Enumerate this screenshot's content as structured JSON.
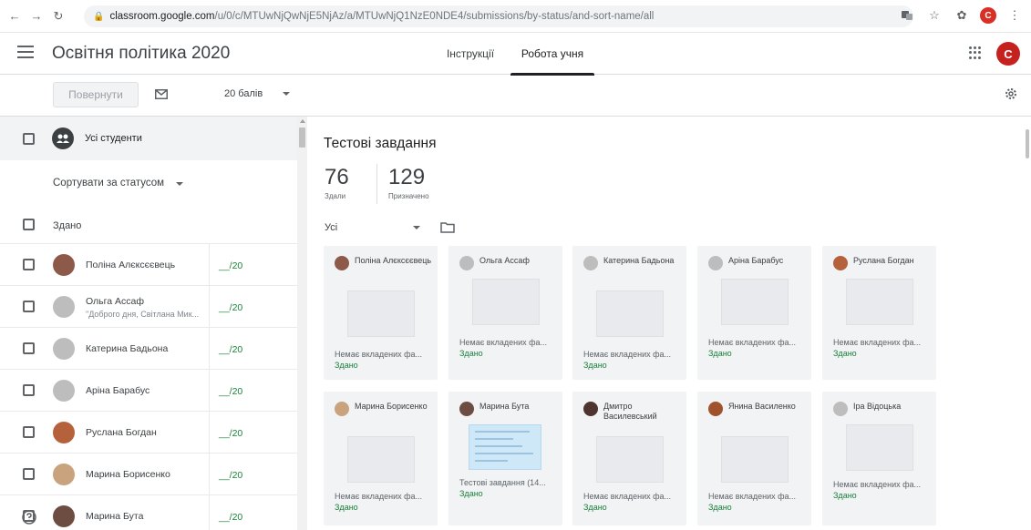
{
  "browser": {
    "url_host": "classroom.google.com",
    "url_path": "/u/0/c/MTUwNjQwNjE5NjAz/a/MTUwNjQ1NzE0NDE4/submissions/by-status/and-sort-name/all",
    "profile_initial": "C"
  },
  "header": {
    "class_title": "Освітня політика 2020",
    "tabs": [
      {
        "label": "Інструкції"
      },
      {
        "label": "Робота учня"
      }
    ],
    "avatar_initial": "C"
  },
  "toolbar": {
    "return_label": "Повернути",
    "points": "20 балів"
  },
  "left": {
    "all_students_label": "Усі студенти",
    "sort_label": "Сортувати за статусом",
    "group_label": "Здано",
    "students": [
      {
        "name": "Поліна Алєксєєвець",
        "comment": "",
        "grade": "__/20",
        "avatar_color": "#8d5a4a"
      },
      {
        "name": "Ольга Ассаф",
        "comment": "\"Доброго дня, Світлана Мик...",
        "grade": "__/20",
        "avatar_color": "#bdbdbd"
      },
      {
        "name": "Катерина Бадьона",
        "comment": "",
        "grade": "__/20",
        "avatar_color": "#bdbdbd"
      },
      {
        "name": "Аріна Барабус",
        "comment": "",
        "grade": "__/20",
        "avatar_color": "#bdbdbd"
      },
      {
        "name": "Руслана Богдан",
        "comment": "",
        "grade": "__/20",
        "avatar_color": "#b5623c"
      },
      {
        "name": "Марина Борисенко",
        "comment": "",
        "grade": "__/20",
        "avatar_color": "#c9a27e"
      },
      {
        "name": "Марина Бута",
        "comment": "",
        "grade": "__/20",
        "avatar_color": "#6d4c41"
      }
    ]
  },
  "right": {
    "assignment_title": "Тестові завдання",
    "turned_in_count": "76",
    "turned_in_label": "Здали",
    "assigned_count": "129",
    "assigned_label": "Призначено",
    "filter_label": "Усі",
    "cards": [
      {
        "name": "Поліна Алєксєєвець",
        "attachment": "Немає вкладених фа...",
        "status": "Здано",
        "avatar_color": "#8d5a4a",
        "has_doc": false
      },
      {
        "name": "Ольга Ассаф",
        "attachment": "Немає вкладених фа...",
        "status": "Здано",
        "avatar_color": "#bdbdbd",
        "has_doc": false
      },
      {
        "name": "Катерина Бадьона",
        "attachment": "Немає вкладених фа...",
        "status": "Здано",
        "avatar_color": "#bdbdbd",
        "has_doc": false
      },
      {
        "name": "Аріна Барабус",
        "attachment": "Немає вкладених фа...",
        "status": "Здано",
        "avatar_color": "#bdbdbd",
        "has_doc": false
      },
      {
        "name": "Руслана Богдан",
        "attachment": "Немає вкладених фа...",
        "status": "Здано",
        "avatar_color": "#b5623c",
        "has_doc": false
      },
      {
        "name": "Марина Борисенко",
        "attachment": "Немає вкладених фа...",
        "status": "Здано",
        "avatar_color": "#c9a27e",
        "has_doc": false
      },
      {
        "name": "Марина Бута",
        "attachment": "Тестові завдання (14...",
        "status": "Здано",
        "avatar_color": "#6d4c41",
        "has_doc": true
      },
      {
        "name": "Дмитро Василевський",
        "attachment": "Немає вкладених фа...",
        "status": "Здано",
        "avatar_color": "#4e342e",
        "has_doc": false
      },
      {
        "name": "Янина Василенко",
        "attachment": "Немає вкладених фа...",
        "status": "Здано",
        "avatar_color": "#a0522d",
        "has_doc": false
      },
      {
        "name": "Іра Відоцька",
        "attachment": "Немає вкладених фа...",
        "status": "Здано",
        "avatar_color": "#bdbdbd",
        "has_doc": false
      }
    ]
  }
}
